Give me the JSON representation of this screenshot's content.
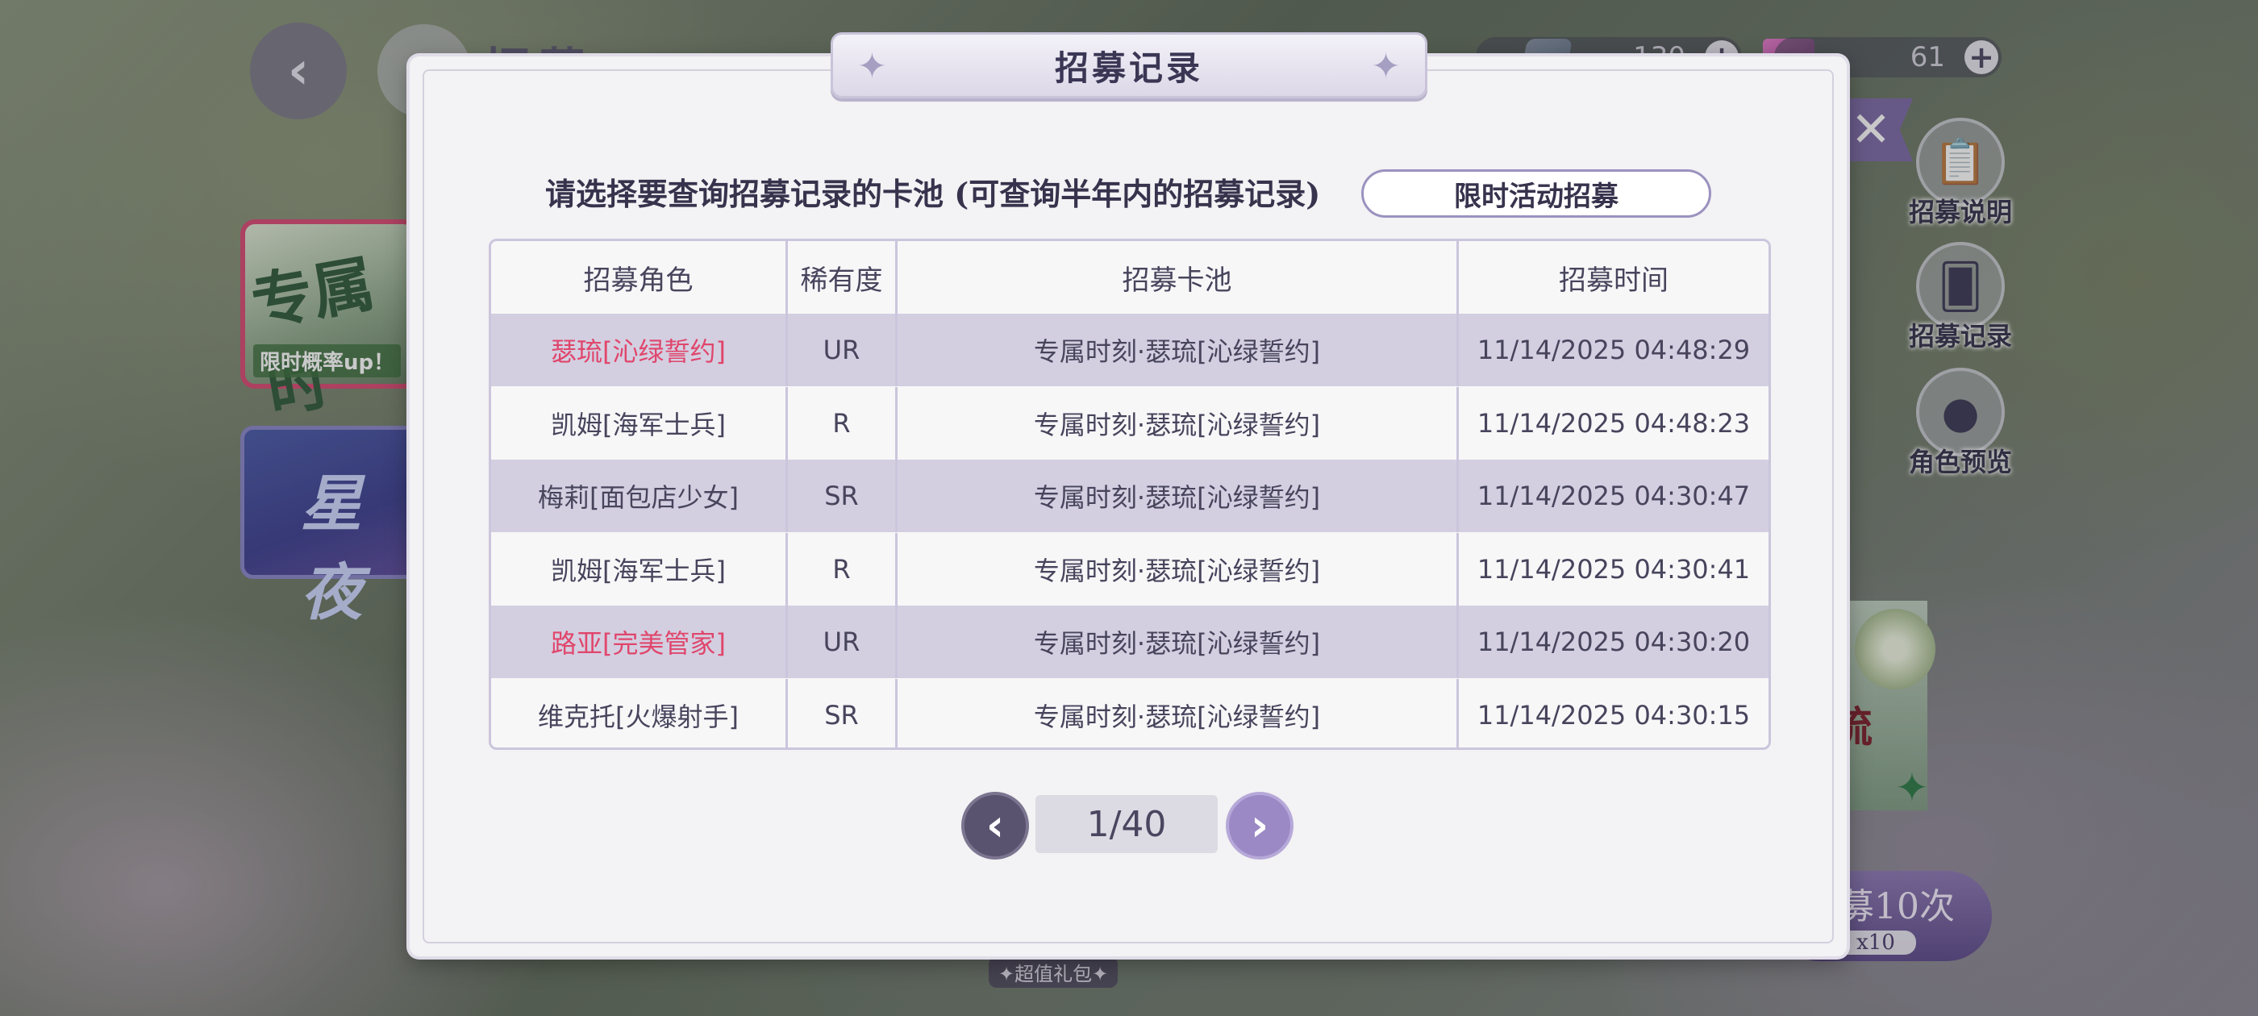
{
  "background": {
    "top_title": "招募",
    "currencies": [
      {
        "value": "130"
      },
      {
        "value": "61"
      }
    ],
    "banners": [
      {
        "title": "专属时",
        "subtitle": "限时概率up！"
      },
      {
        "title": "星夜"
      }
    ],
    "side_buttons": [
      {
        "label": "招募说明",
        "icon": "clipboard-icon"
      },
      {
        "label": "招募记录",
        "icon": "cards-icon"
      },
      {
        "label": "角色预览",
        "icon": "person-icon"
      }
    ],
    "character_name": "琉",
    "recruit_button": {
      "label": "募10次",
      "count": "x10"
    },
    "gift_label": "✦超值礼包✦"
  },
  "modal": {
    "title": "招募记录",
    "hint": "请选择要查询招募记录的卡池 (可查询半年内的招募记录)",
    "pool_select": "限时活动招募",
    "table": {
      "headers": [
        "招募角色",
        "稀有度",
        "招募卡池",
        "招募时间"
      ],
      "rows": [
        {
          "character": "瑟琉[沁绿誓约]",
          "rarity": "UR",
          "pool": "专属时刻·瑟琉[沁绿誓约]",
          "time": "11/14/2025 04:48:29",
          "highlight": true
        },
        {
          "character": "凯姆[海军士兵]",
          "rarity": "R",
          "pool": "专属时刻·瑟琉[沁绿誓约]",
          "time": "11/14/2025 04:48:23",
          "highlight": false
        },
        {
          "character": "梅莉[面包店少女]",
          "rarity": "SR",
          "pool": "专属时刻·瑟琉[沁绿誓约]",
          "time": "11/14/2025 04:30:47",
          "highlight": false
        },
        {
          "character": "凯姆[海军士兵]",
          "rarity": "R",
          "pool": "专属时刻·瑟琉[沁绿誓约]",
          "time": "11/14/2025 04:30:41",
          "highlight": false
        },
        {
          "character": "路亚[完美管家]",
          "rarity": "UR",
          "pool": "专属时刻·瑟琉[沁绿誓约]",
          "time": "11/14/2025 04:30:20",
          "highlight": true
        },
        {
          "character": "维克托[火爆射手]",
          "rarity": "SR",
          "pool": "专属时刻·瑟琉[沁绿誓约]",
          "time": "11/14/2025 04:30:15",
          "highlight": false
        }
      ]
    },
    "pagination": {
      "label": "1/40",
      "current": 1,
      "total": 40
    }
  },
  "colors": {
    "ur_highlight": "#e0466c",
    "row_alt": "#d3cfe1",
    "accent": "#9b89c6"
  }
}
